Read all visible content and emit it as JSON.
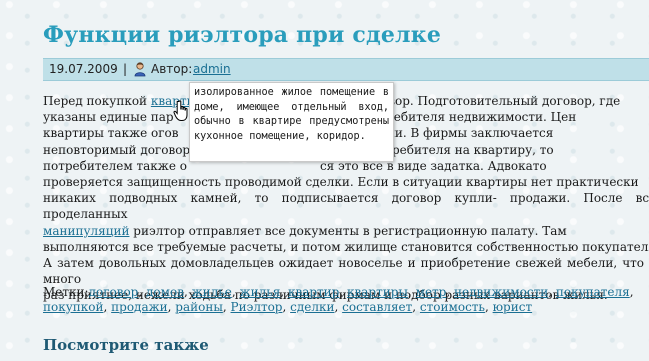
{
  "article": {
    "title": "Функции риэлтора при сделке",
    "date": "19.07.2009",
    "separator": "|",
    "author_label": "Автор:",
    "author_name": "admin"
  },
  "body": {
    "p1_a": "Перед покупкой ",
    "p1_link": "квартир",
    "p1_b": "й договор. Подготовительный договор, где",
    "p2_a": "указаны единые пар",
    "p2_b": "раивают потребителя недвижимости. Цен",
    "p3_a": "квартиры также огов",
    "p3_b": "ных компании. В фирмы заключается",
    "p4_a": "неповторимый договор",
    "p4_b": "аходит потребителя на квартиру, то",
    "p5_a": "потребителем также о",
    "p5_b": "ся это все в виде задатка. Адвокато",
    "p6": "проверяется защищенность проводимой сделки. Если в ситуации квартиры нет практически",
    "p7": "никаких подводных камней, то подписывается договор купли- продажи. После всех проделанных",
    "p8_link": "манипуляций",
    "p8_b": " риэлтор отправляет все документы в регистрационную палату. Там",
    "p9": "выполняются все требуемые расчеты, и потом жилище становится собственностью покупателя.",
    "p10": "А затем довольных домовладельцев ожидает новоселье и приобретение свежей мебели, что во много",
    "p11": "раз приятнее, нежели ходьба по различным фирмам и подбор разных вариантов жилья."
  },
  "tags": {
    "label": "Метки:",
    "items": [
      "договор",
      "домов",
      "жилье",
      "жилья",
      "квартир",
      "квартиры",
      "метр",
      "недвижимости",
      "покупателя",
      "покупкой",
      "продажи",
      "районы",
      "Риэлтор",
      "сделки",
      "составляет",
      "стоимость",
      "юрист"
    ]
  },
  "see_also": "Посмотрите также",
  "tooltip": {
    "text": "изолированное жилое помещение в доме, имеющее отдельный вход, обычно в квартире предусмотрены кухонное помещение, коридор."
  },
  "colors": {
    "title": "#2a9dbc",
    "meta_bar": "#bfe0e8",
    "link": "#1a6f93"
  }
}
